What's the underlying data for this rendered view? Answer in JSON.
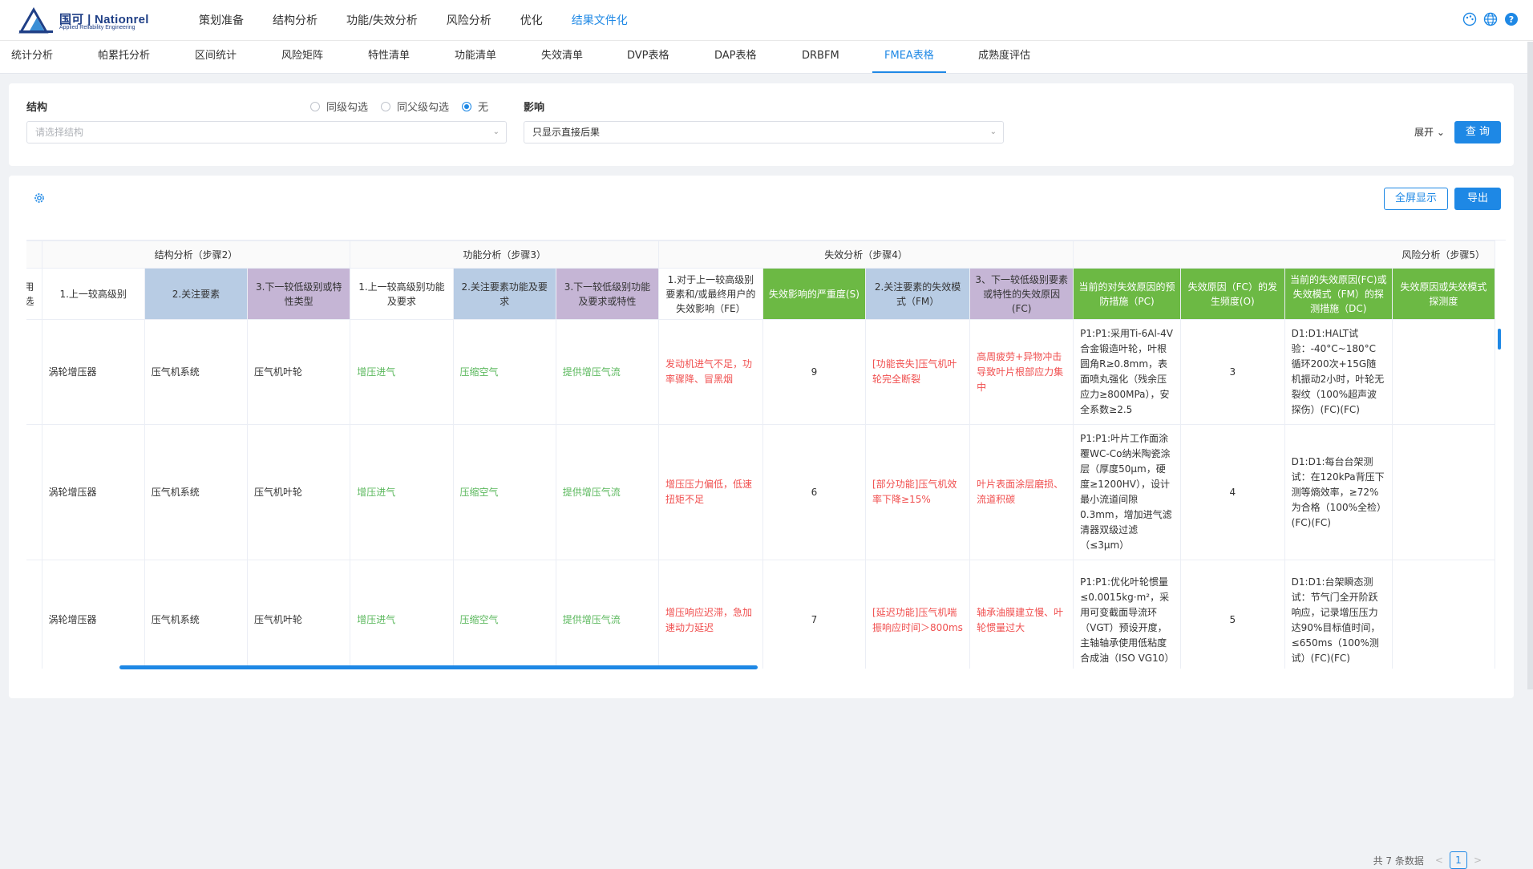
{
  "brand": {
    "name": "国可 | Nationrel",
    "subtitle": "Applied Reliability Engineering"
  },
  "main_nav": [
    {
      "label": "策划准备"
    },
    {
      "label": "结构分析"
    },
    {
      "label": "功能/失效分析"
    },
    {
      "label": "风险分析"
    },
    {
      "label": "优化"
    },
    {
      "label": "结果文件化",
      "active": true
    }
  ],
  "top_icons": [
    "palette-icon",
    "globe-icon",
    "help-icon"
  ],
  "sub_tabs": [
    {
      "label": "统计分析"
    },
    {
      "label": "帕累托分析"
    },
    {
      "label": "区间统计"
    },
    {
      "label": "风险矩阵"
    },
    {
      "label": "特性清单"
    },
    {
      "label": "功能清单"
    },
    {
      "label": "失效清单"
    },
    {
      "label": "DVP表格"
    },
    {
      "label": "DAP表格"
    },
    {
      "label": "DRBFM"
    },
    {
      "label": "FMEA表格",
      "active": true
    },
    {
      "label": "成熟度评估"
    }
  ],
  "filter": {
    "structure_label": "结构",
    "structure_placeholder": "请选择结构",
    "radio_options": [
      {
        "label": "同级勾选",
        "checked": false
      },
      {
        "label": "同父级勾选",
        "checked": false
      },
      {
        "label": "无",
        "checked": true
      }
    ],
    "effect_label": "影响",
    "effect_value": "只显示直接后果",
    "expand_label": "展开",
    "query_label": "查 询"
  },
  "toolbar": {
    "fullscreen_label": "全屏显示",
    "export_label": "导出"
  },
  "table": {
    "group_headers": [
      {
        "label": ""
      },
      {
        "label": "结构分析（步骤2）"
      },
      {
        "label": "功能分析（步骤3）"
      },
      {
        "label": "失效分析（步骤4）"
      },
      {
        "label": "风险分析（步骤5）"
      }
    ],
    "columns": [
      {
        "label": "用选",
        "color": "white"
      },
      {
        "label": "1.上一较高级别",
        "color": "white"
      },
      {
        "label": "2.关注要素",
        "color": "blue"
      },
      {
        "label": "3.下一较低级别或特性类型",
        "color": "purple"
      },
      {
        "label": "1.上一较高级别功能及要求",
        "color": "white"
      },
      {
        "label": "2.关注要素功能及要求",
        "color": "blue"
      },
      {
        "label": "3.下一较低级别功能及要求或特性",
        "color": "purple"
      },
      {
        "label": "1.对于上一较高级别要素和/或最终用户的失效影响（FE）",
        "color": "white"
      },
      {
        "label": "失效影响的严重度(S)",
        "color": "green"
      },
      {
        "label": "2.关注要素的失效模式（FM）",
        "color": "blue"
      },
      {
        "label": "3、下一较低级别要素或特性的失效原因(FC)",
        "color": "purple"
      },
      {
        "label": "当前的对失效原因的预防措施（PC)",
        "color": "green"
      },
      {
        "label": "失效原因（FC）的发生频度(O)",
        "color": "green"
      },
      {
        "label": "当前的失效原因(FC)或失效模式（FM）的探测措施（DC)",
        "color": "green"
      },
      {
        "label": "失效原因或失效模式探测度",
        "color": "green"
      }
    ],
    "rows": [
      {
        "cells": [
          "",
          "涡轮增压器",
          "压气机系统",
          "压气机叶轮",
          "增压进气",
          "压缩空气",
          "提供增压气流",
          "发动机进气不足，功率骤降、冒黑烟",
          "9",
          "[功能丧失]压气机叶轮完全断裂",
          "高周疲劳+异物冲击导致叶片根部应力集中",
          "P1:P1:采用Ti-6Al-4V合金锻造叶轮，叶根圆角R≥0.8mm，表面喷丸强化（残余压应力≥800MPa），安全系数≥2.5",
          "3",
          "D1:D1:HALT试验：-40°C~180°C循环200次+15G随机振动2小时，叶轮无裂纹（100%超声波探伤）(FC)(FC)",
          ""
        ]
      },
      {
        "cells": [
          "",
          "涡轮增压器",
          "压气机系统",
          "压气机叶轮",
          "增压进气",
          "压缩空气",
          "提供增压气流",
          "增压压力偏低，低速扭矩不足",
          "6",
          "[部分功能]压气机效率下降≥15%",
          "叶片表面涂层磨损、流道积碳",
          "P1:P1:叶片工作面涂覆WC-Co纳米陶瓷涂层（厚度50μm，硬度≥1200HV），设计最小流道间隙0.3mm，增加进气滤清器双级过滤（≤3μm）",
          "4",
          "D1:D1:每台台架测试：在120kPa背压下测等熵效率，≥72%为合格（100%全检）(FC)(FC)",
          ""
        ]
      },
      {
        "cells": [
          "",
          "涡轮增压器",
          "压气机系统",
          "压气机叶轮",
          "增压进气",
          "压缩空气",
          "提供增压气流",
          "增压响应迟滞，急加速动力延迟",
          "7",
          "[延迟功能]压气机喘振响应时间＞800ms",
          "轴承油膜建立慢、叶轮惯量过大",
          "P1:P1:优化叶轮惯量≤0.0015kg·m²，采用可变截面导流环（VGT）预设开度，主轴轴承使用低粘度合成油（ISO VG10）",
          "5",
          "D1:D1:台架瞬态测试：节气门全开阶跃响应，记录增压压力达90%目标值时间，≤650ms（100%测试）(FC)(FC)",
          ""
        ]
      }
    ]
  },
  "pagination": {
    "total_label": "共 7 条数据",
    "current_page": "1"
  }
}
